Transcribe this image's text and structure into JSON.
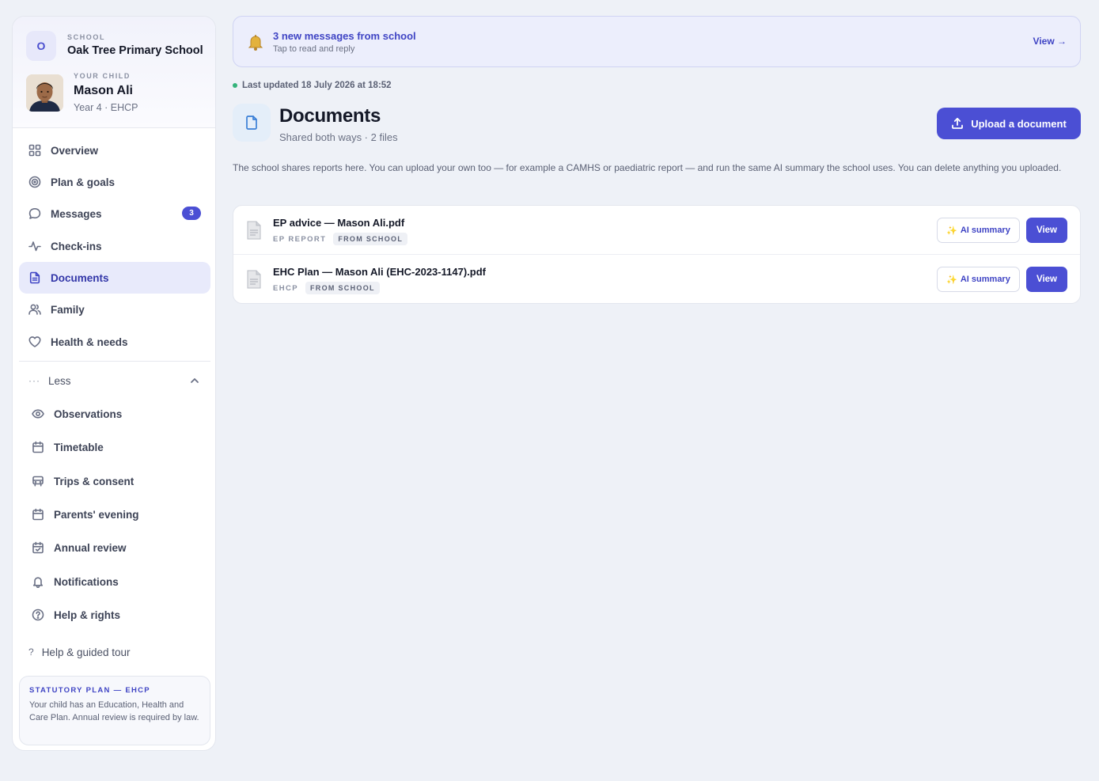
{
  "school": {
    "logo_letter": "O",
    "kicker": "SCHOOL",
    "name": "Oak Tree Primary School"
  },
  "child": {
    "kicker": "YOUR CHILD",
    "name": "Mason Ali",
    "meta": "Year 4 · EHCP"
  },
  "nav": {
    "primary": [
      {
        "label": "Overview",
        "icon": "grid-icon"
      },
      {
        "label": "Plan & goals",
        "icon": "target-icon"
      },
      {
        "label": "Messages",
        "icon": "chat-bubble-icon",
        "badge": "3"
      },
      {
        "label": "Check-ins",
        "icon": "pulse-icon"
      },
      {
        "label": "Documents",
        "icon": "document-icon",
        "active": true
      },
      {
        "label": "Family",
        "icon": "users-icon"
      },
      {
        "label": "Health & needs",
        "icon": "heart-icon"
      }
    ],
    "less_toggle": {
      "dots": "···",
      "label": "Less"
    },
    "secondary": [
      {
        "label": "Observations",
        "icon": "eye-icon"
      },
      {
        "label": "Timetable",
        "icon": "calendar-icon"
      },
      {
        "label": "Trips & consent",
        "icon": "bus-icon"
      },
      {
        "label": "Parents' evening",
        "icon": "calendar-icon"
      },
      {
        "label": "Annual review",
        "icon": "calendar-check-icon"
      },
      {
        "label": "Notifications",
        "icon": "bell-icon"
      },
      {
        "label": "Help & rights",
        "icon": "help-circle-icon"
      }
    ],
    "tour": {
      "q": "?",
      "label": "Help & guided tour"
    }
  },
  "statutory": {
    "title": "STATUTORY PLAN — EHCP",
    "text": "Your child has an Education, Health and Care Plan. Annual review is required by law."
  },
  "banner": {
    "title": "3 new messages from school",
    "subtitle": "Tap to read and reply",
    "view": "View →"
  },
  "status": {
    "updated": "Last updated 18 July 2026 at 18:52",
    "color": "#34b37a"
  },
  "page": {
    "title": "Documents",
    "subtitle": "Shared both ways · 2 files",
    "upload_label": "Upload a document",
    "intro": "The school shares reports here. You can upload your own too — for example a CAMHS or paediatric report — and run the same AI summary the school uses. You can delete anything you uploaded."
  },
  "documents": [
    {
      "name": "EP advice — Mason Ali.pdf",
      "type": "EP REPORT",
      "source": "FROM SCHOOL",
      "ai_label": "AI summary",
      "view_label": "View"
    },
    {
      "name": "EHC Plan — Mason Ali (EHC-2023-1147).pdf",
      "type": "EHCP",
      "source": "FROM SCHOOL",
      "ai_label": "AI summary",
      "view_label": "View"
    }
  ],
  "colors": {
    "accent": "#4b4fd4",
    "accent_text": "#3f44c4",
    "active_bg": "#e8eafb"
  }
}
